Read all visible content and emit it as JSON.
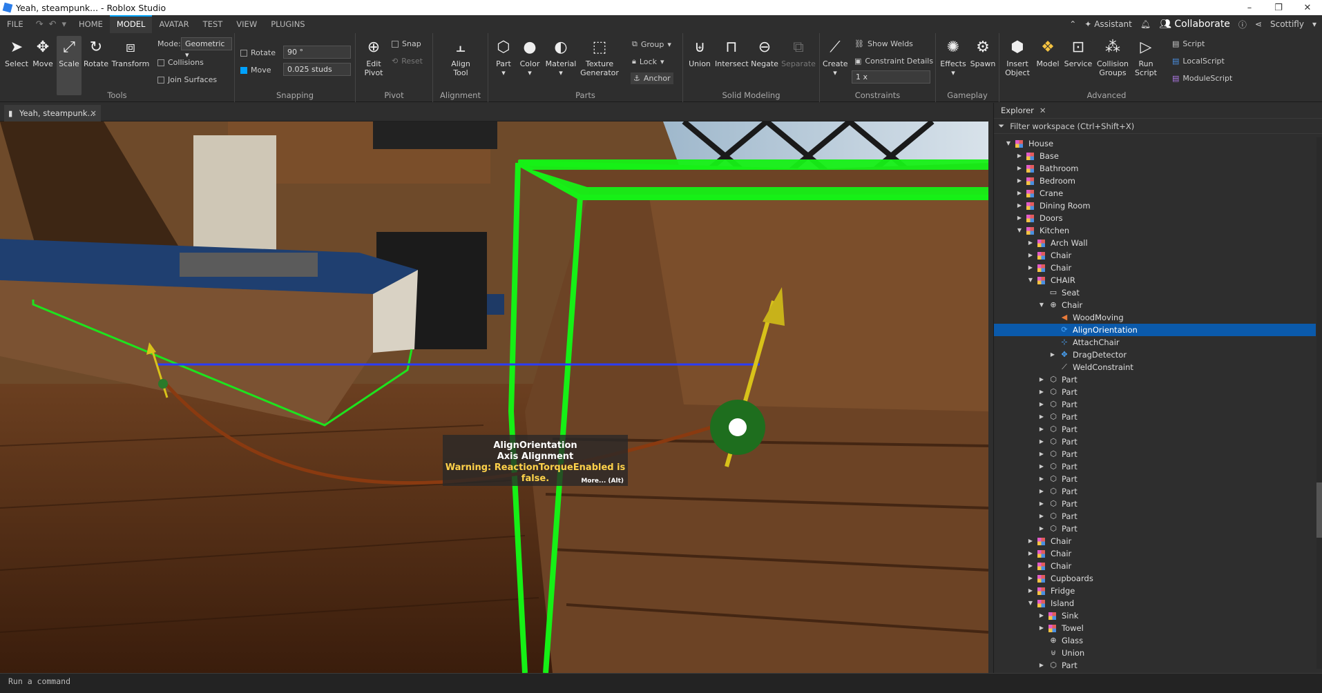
{
  "window": {
    "title": "Yeah, steampunk... - Roblox Studio",
    "minimize": "–",
    "maximize": "❐",
    "close": "✕"
  },
  "menu": {
    "file": "FILE",
    "home": "HOME",
    "model": "MODEL",
    "avatar": "AVATAR",
    "test": "TEST",
    "view": "VIEW",
    "plugins": "PLUGINS",
    "assistant": "Assistant",
    "collaborate": "Collaborate",
    "user": "Scottifly"
  },
  "ribbon": {
    "tools": {
      "label": "Tools",
      "select": "Select",
      "move": "Move",
      "scale": "Scale",
      "rotate": "Rotate",
      "transform": "Transform",
      "mode_label": "Mode:",
      "mode_value": "Geometric",
      "collisions": "Collisions",
      "join_surfaces": "Join Surfaces"
    },
    "snapping": {
      "label": "Snapping",
      "rotate": "Rotate",
      "rotate_value": "90 °",
      "move": "Move",
      "move_value": "0.025 studs"
    },
    "pivot": {
      "label": "Pivot",
      "edit_pivot_1": "Edit",
      "edit_pivot_2": "Pivot",
      "snap": "Snap",
      "reset": "Reset"
    },
    "alignment": {
      "label": "Alignment",
      "align_1": "Align",
      "align_2": "Tool"
    },
    "parts": {
      "label": "Parts",
      "part": "Part",
      "color": "Color",
      "material": "Material",
      "texture_1": "Texture",
      "texture_2": "Generator",
      "group": "Group",
      "lock": "Lock",
      "anchor": "Anchor"
    },
    "solid_modeling": {
      "label": "Solid Modeling",
      "union": "Union",
      "intersect": "Intersect",
      "negate": "Negate",
      "separate": "Separate"
    },
    "constraints": {
      "label": "Constraints",
      "create": "Create",
      "show_welds": "Show Welds",
      "constraint_details": "Constraint Details",
      "scale_value": "1 x"
    },
    "gameplay": {
      "label": "Gameplay",
      "effects": "Effects",
      "spawn": "Spawn"
    },
    "advanced": {
      "label": "Advanced",
      "insert_1": "Insert",
      "insert_2": "Object",
      "model": "Model",
      "service": "Service",
      "collision_1": "Collision",
      "collision_2": "Groups",
      "run_1": "Run",
      "run_2": "Script",
      "script": "Script",
      "local_script": "LocalScript",
      "module_script": "ModuleScript"
    }
  },
  "doc_tab": {
    "title": "Yeah, steampunk...",
    "close": "✕"
  },
  "tooltip": {
    "line1": "AlignOrientation",
    "line2": "Axis Alignment",
    "line3": "Warning: ReactionTorqueEnabled is false.",
    "more": "More... (Alt)"
  },
  "explorer": {
    "title": "Explorer",
    "close": "✕",
    "filter": "Filter workspace (Ctrl+Shift+X)",
    "items": [
      {
        "label": "House",
        "depth": 0,
        "arrow": "open",
        "icon": "model"
      },
      {
        "label": "Base",
        "depth": 1,
        "arrow": "closed",
        "icon": "model"
      },
      {
        "label": "Bathroom",
        "depth": 1,
        "arrow": "closed",
        "icon": "model"
      },
      {
        "label": "Bedroom",
        "depth": 1,
        "arrow": "closed",
        "icon": "model"
      },
      {
        "label": "Crane",
        "depth": 1,
        "arrow": "closed",
        "icon": "model"
      },
      {
        "label": "Dining Room",
        "depth": 1,
        "arrow": "closed",
        "icon": "model"
      },
      {
        "label": "Doors",
        "depth": 1,
        "arrow": "closed",
        "icon": "model"
      },
      {
        "label": "Kitchen",
        "depth": 1,
        "arrow": "open",
        "icon": "model"
      },
      {
        "label": "Arch Wall",
        "depth": 2,
        "arrow": "closed",
        "icon": "model"
      },
      {
        "label": "Chair",
        "depth": 2,
        "arrow": "closed",
        "icon": "model"
      },
      {
        "label": "Chair",
        "depth": 2,
        "arrow": "closed",
        "icon": "model"
      },
      {
        "label": "CHAIR",
        "depth": 2,
        "arrow": "open",
        "icon": "model"
      },
      {
        "label": "Seat",
        "depth": 3,
        "arrow": "none",
        "icon": "seat"
      },
      {
        "label": "Chair",
        "depth": 3,
        "arrow": "open",
        "icon": "mesh"
      },
      {
        "label": "WoodMoving",
        "depth": 4,
        "arrow": "none",
        "icon": "sound"
      },
      {
        "label": "AlignOrientation",
        "depth": 4,
        "arrow": "none",
        "icon": "constraint",
        "selected": true
      },
      {
        "label": "AttachChair",
        "depth": 4,
        "arrow": "none",
        "icon": "attachment"
      },
      {
        "label": "DragDetector",
        "depth": 4,
        "arrow": "closed",
        "icon": "drag"
      },
      {
        "label": "WeldConstraint",
        "depth": 4,
        "arrow": "none",
        "icon": "weld"
      },
      {
        "label": "Part",
        "depth": 3,
        "arrow": "closed",
        "icon": "part"
      },
      {
        "label": "Part",
        "depth": 3,
        "arrow": "closed",
        "icon": "part"
      },
      {
        "label": "Part",
        "depth": 3,
        "arrow": "closed",
        "icon": "part"
      },
      {
        "label": "Part",
        "depth": 3,
        "arrow": "closed",
        "icon": "part"
      },
      {
        "label": "Part",
        "depth": 3,
        "arrow": "closed",
        "icon": "part"
      },
      {
        "label": "Part",
        "depth": 3,
        "arrow": "closed",
        "icon": "part"
      },
      {
        "label": "Part",
        "depth": 3,
        "arrow": "closed",
        "icon": "part"
      },
      {
        "label": "Part",
        "depth": 3,
        "arrow": "closed",
        "icon": "part"
      },
      {
        "label": "Part",
        "depth": 3,
        "arrow": "closed",
        "icon": "part"
      },
      {
        "label": "Part",
        "depth": 3,
        "arrow": "closed",
        "icon": "part"
      },
      {
        "label": "Part",
        "depth": 3,
        "arrow": "closed",
        "icon": "part"
      },
      {
        "label": "Part",
        "depth": 3,
        "arrow": "closed",
        "icon": "part"
      },
      {
        "label": "Part",
        "depth": 3,
        "arrow": "closed",
        "icon": "part"
      },
      {
        "label": "Chair",
        "depth": 2,
        "arrow": "closed",
        "icon": "model"
      },
      {
        "label": "Chair",
        "depth": 2,
        "arrow": "closed",
        "icon": "model"
      },
      {
        "label": "Chair",
        "depth": 2,
        "arrow": "closed",
        "icon": "model"
      },
      {
        "label": "Cupboards",
        "depth": 2,
        "arrow": "closed",
        "icon": "model"
      },
      {
        "label": "Fridge",
        "depth": 2,
        "arrow": "closed",
        "icon": "model"
      },
      {
        "label": "Island",
        "depth": 2,
        "arrow": "open",
        "icon": "model"
      },
      {
        "label": "Sink",
        "depth": 3,
        "arrow": "closed",
        "icon": "model"
      },
      {
        "label": "Towel",
        "depth": 3,
        "arrow": "closed",
        "icon": "model"
      },
      {
        "label": "Glass",
        "depth": 3,
        "arrow": "none",
        "icon": "mesh"
      },
      {
        "label": "Union",
        "depth": 3,
        "arrow": "none",
        "icon": "union"
      },
      {
        "label": "Part",
        "depth": 3,
        "arrow": "closed",
        "icon": "part"
      }
    ]
  },
  "command_bar": {
    "placeholder": "Run a command"
  }
}
